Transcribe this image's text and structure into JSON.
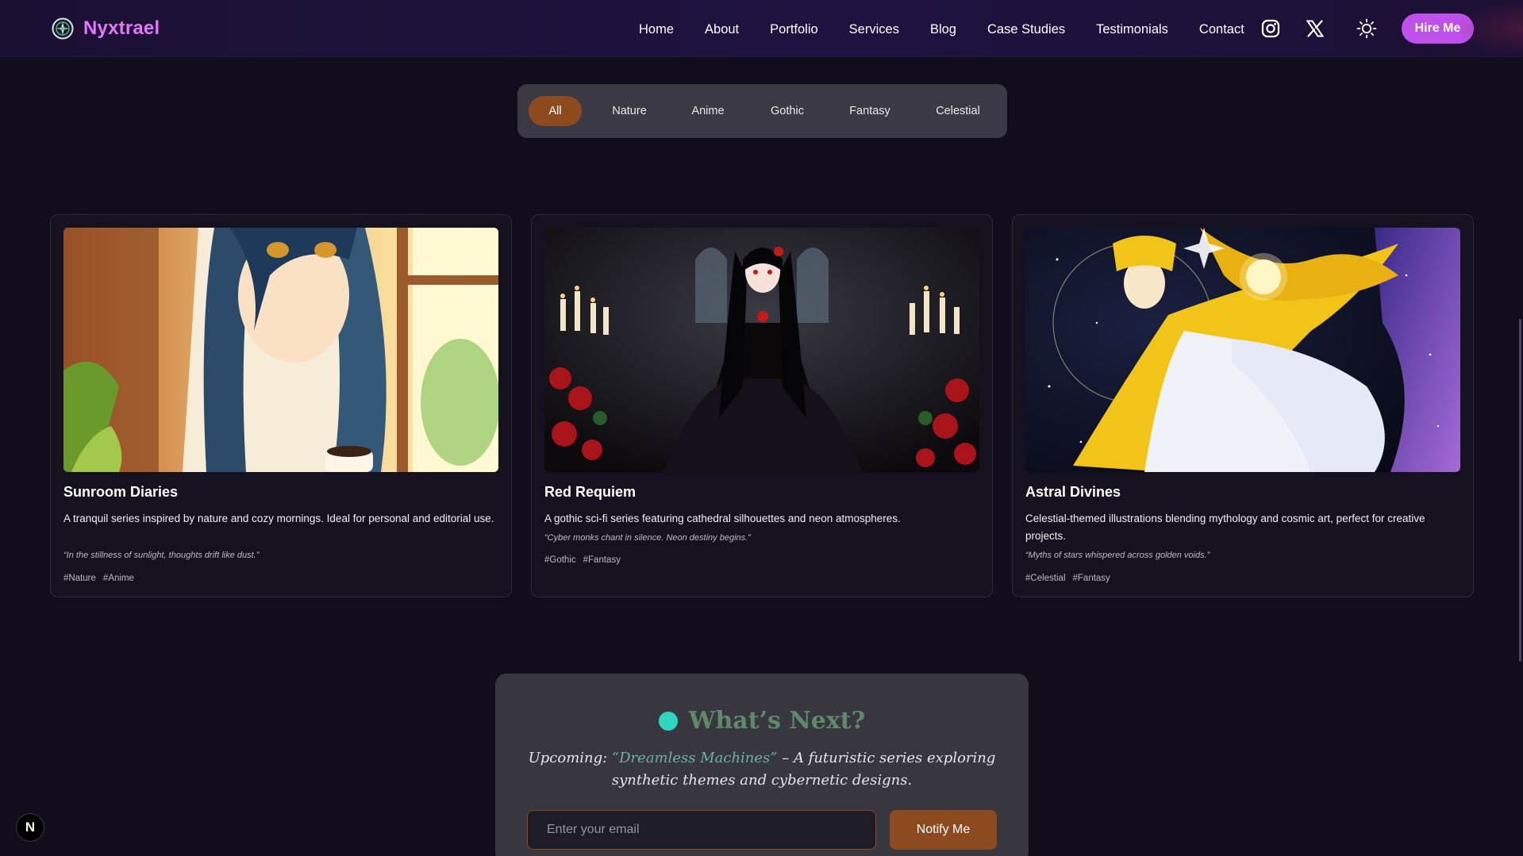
{
  "brand": {
    "name": "Nyxtrael",
    "logo_icon": "compass-logo-icon",
    "color": "#e776ff"
  },
  "nav": {
    "links": [
      "Home",
      "About",
      "Portfolio",
      "Services",
      "Blog",
      "Case Studies",
      "Testimonials",
      "Contact"
    ],
    "icons": [
      "instagram-icon",
      "x-twitter-icon",
      "sun-theme-toggle-icon"
    ],
    "hire_label": "Hire Me",
    "hire_color": "#c050ec"
  },
  "filters": {
    "items": [
      "All",
      "Nature",
      "Anime",
      "Gothic",
      "Fantasy",
      "Celestial"
    ],
    "active": "All",
    "active_color": "#8e4a1f"
  },
  "cards": [
    {
      "title": "Sunroom Diaries",
      "description": "A tranquil series inspired by nature and cozy mornings. Ideal for personal and editorial use.",
      "quote": "“In the stillness of sunlight, thoughts drift like dust.”",
      "tags": [
        "#Nature",
        "#Anime"
      ]
    },
    {
      "title": "Red Requiem",
      "description": "A gothic sci-fi series featuring cathedral silhouettes and neon atmospheres.",
      "quote": "“Cyber monks chant in silence. Neon destiny begins.”",
      "tags": [
        "#Gothic",
        "#Fantasy"
      ]
    },
    {
      "title": "Astral Divines",
      "description": "Celestial-themed illustrations blending mythology and cosmic art, perfect for creative projects.",
      "quote": "“Myths of stars whispered across golden voids.”",
      "tags": [
        "#Celestial",
        "#Fantasy"
      ]
    }
  ],
  "next": {
    "title": "What’s Next?",
    "prefix": "Upcoming: ",
    "highlight": "“Dreamless Machines”",
    "suffix": " – A futuristic series exploring synthetic themes and cybernetic designs.",
    "email_placeholder": "Enter your email",
    "button_label": "Notify Me"
  },
  "floating_badge": "N"
}
